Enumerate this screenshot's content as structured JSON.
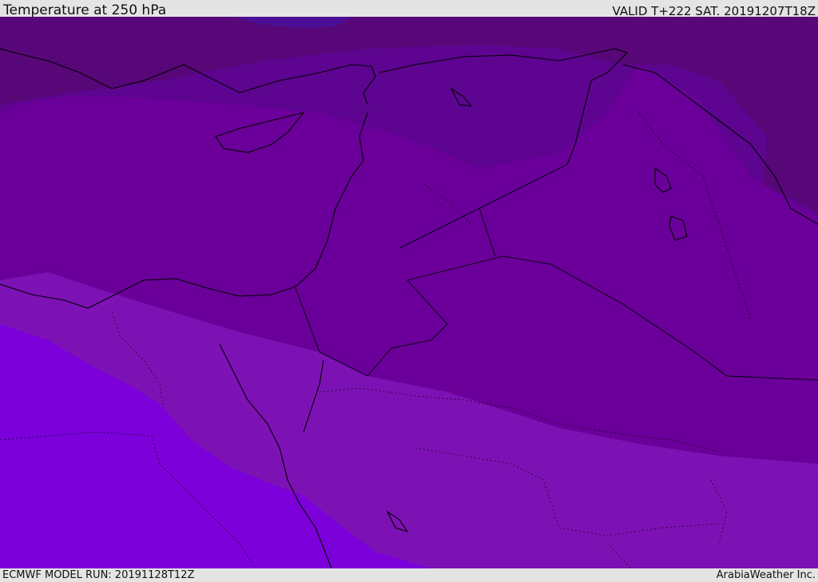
{
  "header": {
    "title": "Temperature at 250 hPa",
    "valid": "VALID T+222 SAT. 20191207T18Z"
  },
  "footer": {
    "model_run": "ECMWF MODEL RUN: 20191128T12Z",
    "credit": "ArabiaWeather Inc."
  },
  "map": {
    "field": "temperature",
    "level": "250 hPa",
    "colors": {
      "band_coldest": "#4a0f96",
      "band_1": "#570778",
      "band_2": "#610691",
      "band_3": "#6a0099",
      "band_4": "#7d12b4",
      "band_warmest": "#7b00d9",
      "coastline": "#000000"
    }
  }
}
